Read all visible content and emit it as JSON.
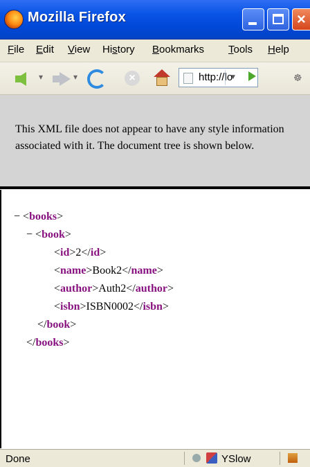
{
  "window": {
    "title": "Mozilla Firefox",
    "close_glyph": "×",
    "icon": "firefox-logo-icon"
  },
  "menu": {
    "items": [
      {
        "label": "File",
        "underline": "F"
      },
      {
        "label": "Edit",
        "underline": "E"
      },
      {
        "label": "View",
        "underline": "V"
      },
      {
        "label": "History",
        "underline": "s"
      },
      {
        "label": "Bookmarks",
        "underline": "B"
      },
      {
        "label": "Tools",
        "underline": "T"
      },
      {
        "label": "Help",
        "underline": "H"
      }
    ]
  },
  "toolbar": {
    "url": "http://lo",
    "icons": [
      "back-icon",
      "forward-icon",
      "reload-icon",
      "stop-icon",
      "home-icon",
      "go-icon"
    ]
  },
  "banner": {
    "message": "This XML file does not appear to have any style information associated with it. The document tree is shown below."
  },
  "xml": {
    "collapse_glyph": "−",
    "root_tag": "books",
    "child_tag": "book",
    "fields": [
      {
        "tag": "id",
        "value": "2"
      },
      {
        "tag": "name",
        "value": "Book2"
      },
      {
        "tag": "author",
        "value": "Auth2"
      },
      {
        "tag": "isbn",
        "value": "ISBN0002"
      }
    ]
  },
  "status": {
    "text": "Done",
    "addon_label": "YSlow"
  },
  "colors": {
    "titlebar": "#0a54e6",
    "xml_tag": "#881280",
    "banner_bg": "#d4d4d4"
  }
}
